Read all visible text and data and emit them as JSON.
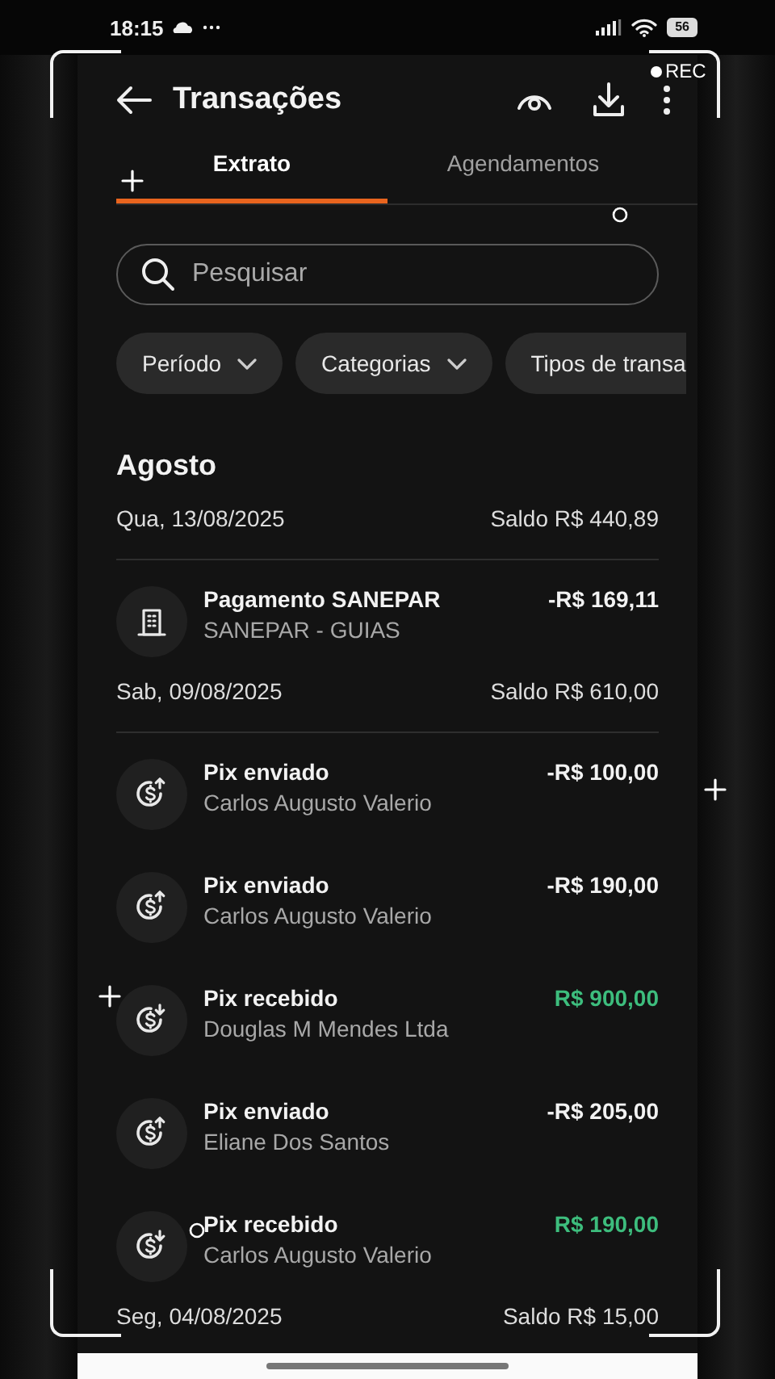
{
  "status_bar": {
    "time": "18:15",
    "battery": "56"
  },
  "recording": {
    "label": "REC"
  },
  "header": {
    "title": "Transações"
  },
  "tabs": [
    {
      "label": "Extrato",
      "selected": true
    },
    {
      "label": "Agendamentos",
      "selected": false
    }
  ],
  "search": {
    "placeholder": "Pesquisar"
  },
  "filters": [
    {
      "label": "Período",
      "chevron": true
    },
    {
      "label": "Categorias",
      "chevron": true
    },
    {
      "label": "Tipos de transa",
      "chevron": false
    }
  ],
  "month": "Agosto",
  "days": [
    {
      "date": "Qua, 13/08/2025",
      "balance": "Saldo R$ 440,89",
      "transactions": [
        {
          "kind": "bill",
          "title": "Pagamento SANEPAR",
          "subtitle": "SANEPAR - GUIAS",
          "amount": "-R$ 169,11",
          "credit": false
        }
      ]
    },
    {
      "date": "Sab, 09/08/2025",
      "balance": "Saldo R$ 610,00",
      "transactions": [
        {
          "kind": "pix_out",
          "title": "Pix enviado",
          "subtitle": "Carlos Augusto Valerio",
          "amount": "-R$ 100,00",
          "credit": false
        },
        {
          "kind": "pix_out",
          "title": "Pix enviado",
          "subtitle": "Carlos Augusto Valerio",
          "amount": "-R$ 190,00",
          "credit": false
        },
        {
          "kind": "pix_in",
          "title": "Pix recebido",
          "subtitle": "Douglas M Mendes Ltda",
          "amount": "R$ 900,00",
          "credit": true
        },
        {
          "kind": "pix_out",
          "title": "Pix enviado",
          "subtitle": "Eliane Dos Santos",
          "amount": "-R$ 205,00",
          "credit": false
        },
        {
          "kind": "pix_in",
          "title": "Pix recebido",
          "subtitle": "Carlos Augusto Valerio",
          "amount": "R$ 190,00",
          "credit": true
        }
      ]
    },
    {
      "date": "Seg, 04/08/2025",
      "balance": "Saldo R$ 15,00"
    }
  ]
}
